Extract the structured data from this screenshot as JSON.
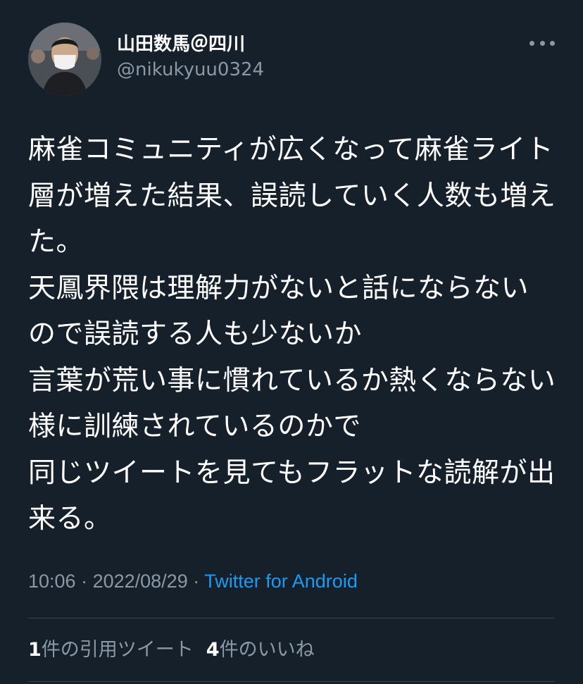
{
  "author": {
    "display_name": "山田数馬＠四川",
    "handle": "@nikukyuu0324"
  },
  "more_icon": "more-horizontal-icon",
  "tweet": {
    "text": "麻雀コミュニティが広くなって麻雀ライト層が増えた結果、誤読していく人数も増えた。\n天鳳界隈は理解力がないと話にならないので誤読する人も少ないか\n言葉が荒い事に慣れているか熱くならない様に訓練されているのかで\n同じツイートを見てもフラットな読解が出来る。"
  },
  "meta": {
    "time": "10:06",
    "separator": " · ",
    "date": "2022/08/29",
    "source": "Twitter for Android"
  },
  "stats": {
    "quotes_count": "1",
    "quotes_label": "件の引用ツイート",
    "likes_count": "4",
    "likes_label": "件のいいね"
  },
  "colors": {
    "background": "#15202b",
    "text_primary": "#ffffff",
    "text_secondary": "#8b98a5",
    "link": "#1d9bf0",
    "divider": "#38444d"
  }
}
